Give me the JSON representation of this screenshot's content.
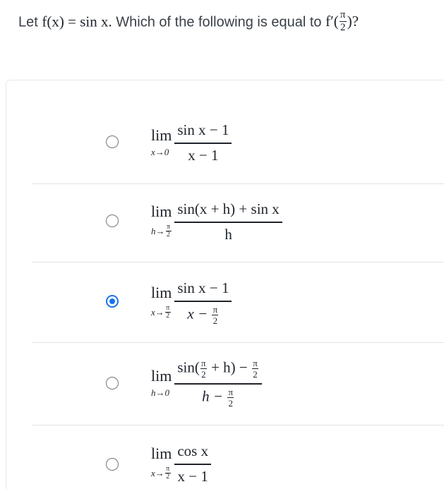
{
  "question": {
    "prefix": "Let",
    "f_def": "f(x) = sin x.",
    "main_text": "Which of the following is equal to",
    "target_left": "f′(",
    "target_pi": "π",
    "target_two": "2",
    "target_right": ")?"
  },
  "choices": [
    {
      "selected": false,
      "lim_word": "lim",
      "lim_sub": "x→0",
      "numerator": "sin x − 1",
      "denominator": "x − 1"
    },
    {
      "selected": false,
      "lim_word": "lim",
      "lim_sub": "h→",
      "lim_sub_frac": [
        "π",
        "2"
      ],
      "numerator": "sin(x + h) + sin x",
      "denominator": "h"
    },
    {
      "selected": true,
      "lim_word": "lim",
      "lim_sub": "x→",
      "lim_sub_frac": [
        "π",
        "2"
      ],
      "numerator": "sin x − 1",
      "denominator_prefix": "x −",
      "denominator_frac": [
        "π",
        "2"
      ]
    },
    {
      "selected": false,
      "lim_word": "lim",
      "lim_sub": "h→0",
      "numerator_prefix": "sin(",
      "numerator_frac1": [
        "π",
        "2"
      ],
      "numerator_middle": "+ h) −",
      "numerator_frac2": [
        "π",
        "2"
      ],
      "denominator_prefix": "h −",
      "denominator_frac": [
        "π",
        "2"
      ]
    },
    {
      "selected": false,
      "lim_word": "lim",
      "lim_sub": "x→",
      "lim_sub_frac": [
        "π",
        "2"
      ],
      "numerator": "cos x",
      "denominator": "x − 1"
    }
  ]
}
